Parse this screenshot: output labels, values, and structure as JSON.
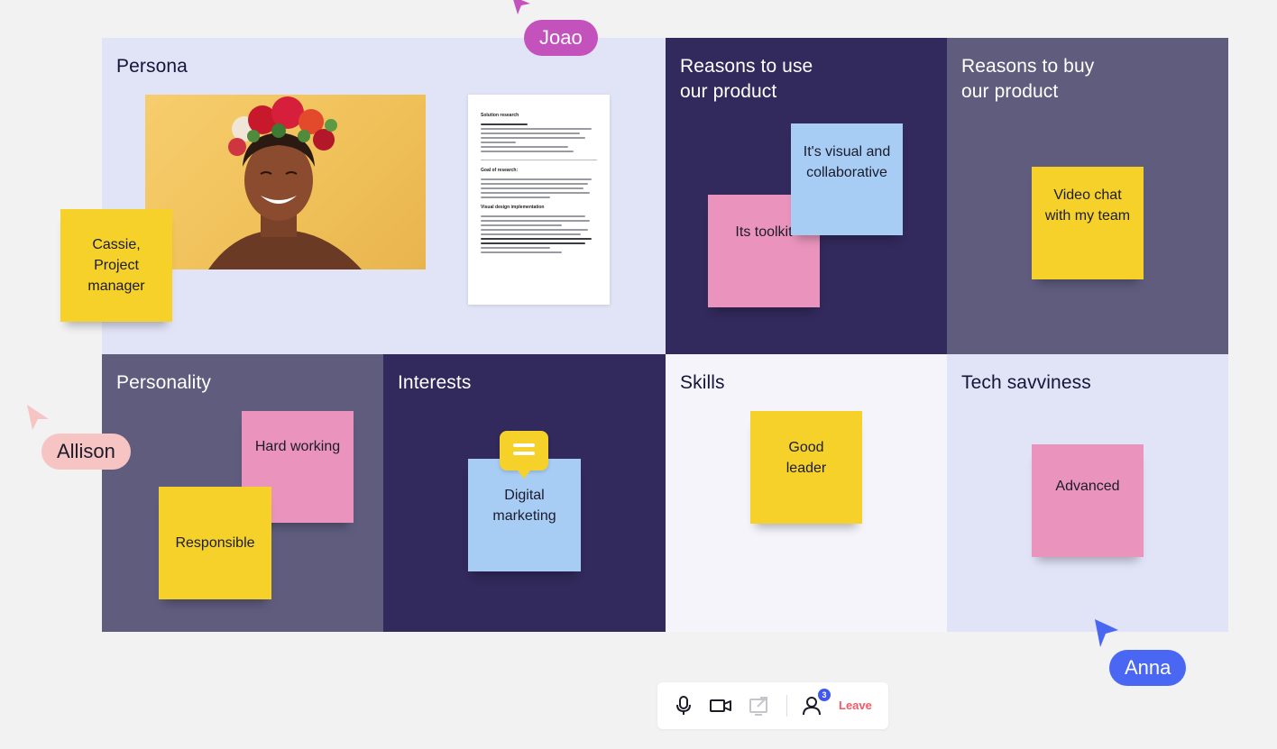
{
  "board": {
    "cells": {
      "persona": {
        "title": "Persona",
        "bg": "#e1e3f7",
        "text_color": "#15153a"
      },
      "reasons_use": {
        "title": "Reasons to use\nour product",
        "bg": "#32295c",
        "text_color": "#ffffff"
      },
      "reasons_buy": {
        "title": "Reasons to buy\nour product",
        "bg": "#5f5c7e",
        "text_color": "#ffffff"
      },
      "personality": {
        "title": "Personality",
        "bg": "#5f5c7e",
        "text_color": "#ffffff"
      },
      "interests": {
        "title": "Interests",
        "bg": "#32295c",
        "text_color": "#ffffff"
      },
      "skills": {
        "title": "Skills",
        "bg": "#f4f4fa",
        "text_color": "#15153a"
      },
      "tech": {
        "title": "Tech savviness",
        "bg": "#e1e3f7",
        "text_color": "#15153a"
      }
    },
    "stickies": {
      "cassie": "Cassie,\nProject\nmanager",
      "visual": "It's visual and\ncollaborative",
      "toolkit": "Its toolkit",
      "video_chat": "Video chat\nwith my team",
      "hard_working": "Hard working",
      "responsible": "Responsible",
      "digital_marketing": "Digital\nmarketing",
      "good_leader": "Good\nleader",
      "advanced": "Advanced"
    },
    "document": {
      "title": "Solution research",
      "section_1": "Goal of research:",
      "section_2": "Visual design implementation"
    }
  },
  "cursors": {
    "joao": {
      "name": "Joao",
      "color": "#c452bd",
      "text_color": "#ffffff"
    },
    "allison": {
      "name": "Allison",
      "color": "#f7c4c4",
      "text_color": "#1b1b2a"
    },
    "anna": {
      "name": "Anna",
      "color": "#4967f2",
      "text_color": "#ffffff"
    }
  },
  "toolbar": {
    "participants_count": "3",
    "leave_label": "Leave",
    "icons": [
      "microphone-icon",
      "video-camera-icon",
      "share-screen-icon",
      "participants-icon"
    ]
  },
  "colors": {
    "sticky_yellow": "#f5d129",
    "sticky_pink": "#ea94bd",
    "sticky_blue": "#a8cdf5",
    "accent_leave": "#f05a6a"
  }
}
